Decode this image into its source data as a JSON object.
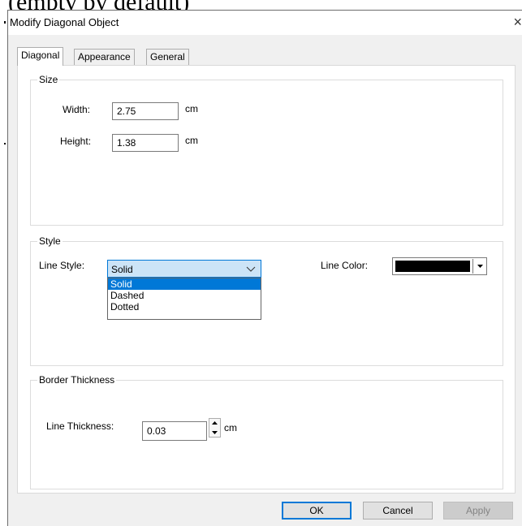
{
  "background": {
    "fragment_text": "(empty by default)"
  },
  "dialog": {
    "title": "Modify Diagonal Object",
    "close_glyph": "×",
    "tabs": [
      {
        "label": "Diagonal",
        "active": true
      },
      {
        "label": "Appearance",
        "active": false
      },
      {
        "label": "General",
        "active": false
      }
    ],
    "size": {
      "group_label": "Size",
      "width_label": "Width:",
      "width_value": "2.75",
      "width_unit": "cm",
      "height_label": "Height:",
      "height_value": "1.38",
      "height_unit": "cm"
    },
    "style": {
      "group_label": "Style",
      "line_style_label": "Line Style:",
      "line_style_value": "Solid",
      "line_style_options": [
        "Solid",
        "Dashed",
        "Dotted"
      ],
      "line_color_label": "Line Color:",
      "line_color_value": "#000000"
    },
    "border": {
      "group_label": "Border Thickness",
      "line_thickness_label": "Line Thickness:",
      "line_thickness_value": "0.03",
      "line_thickness_unit": "cm"
    },
    "buttons": {
      "ok": "OK",
      "cancel": "Cancel",
      "apply": "Apply"
    }
  },
  "colors": {
    "accent": "#0078d7",
    "combo_highlight": "#cce4f7",
    "dialog_bg": "#f0f0f0",
    "panel_bg": "#ffffff"
  }
}
